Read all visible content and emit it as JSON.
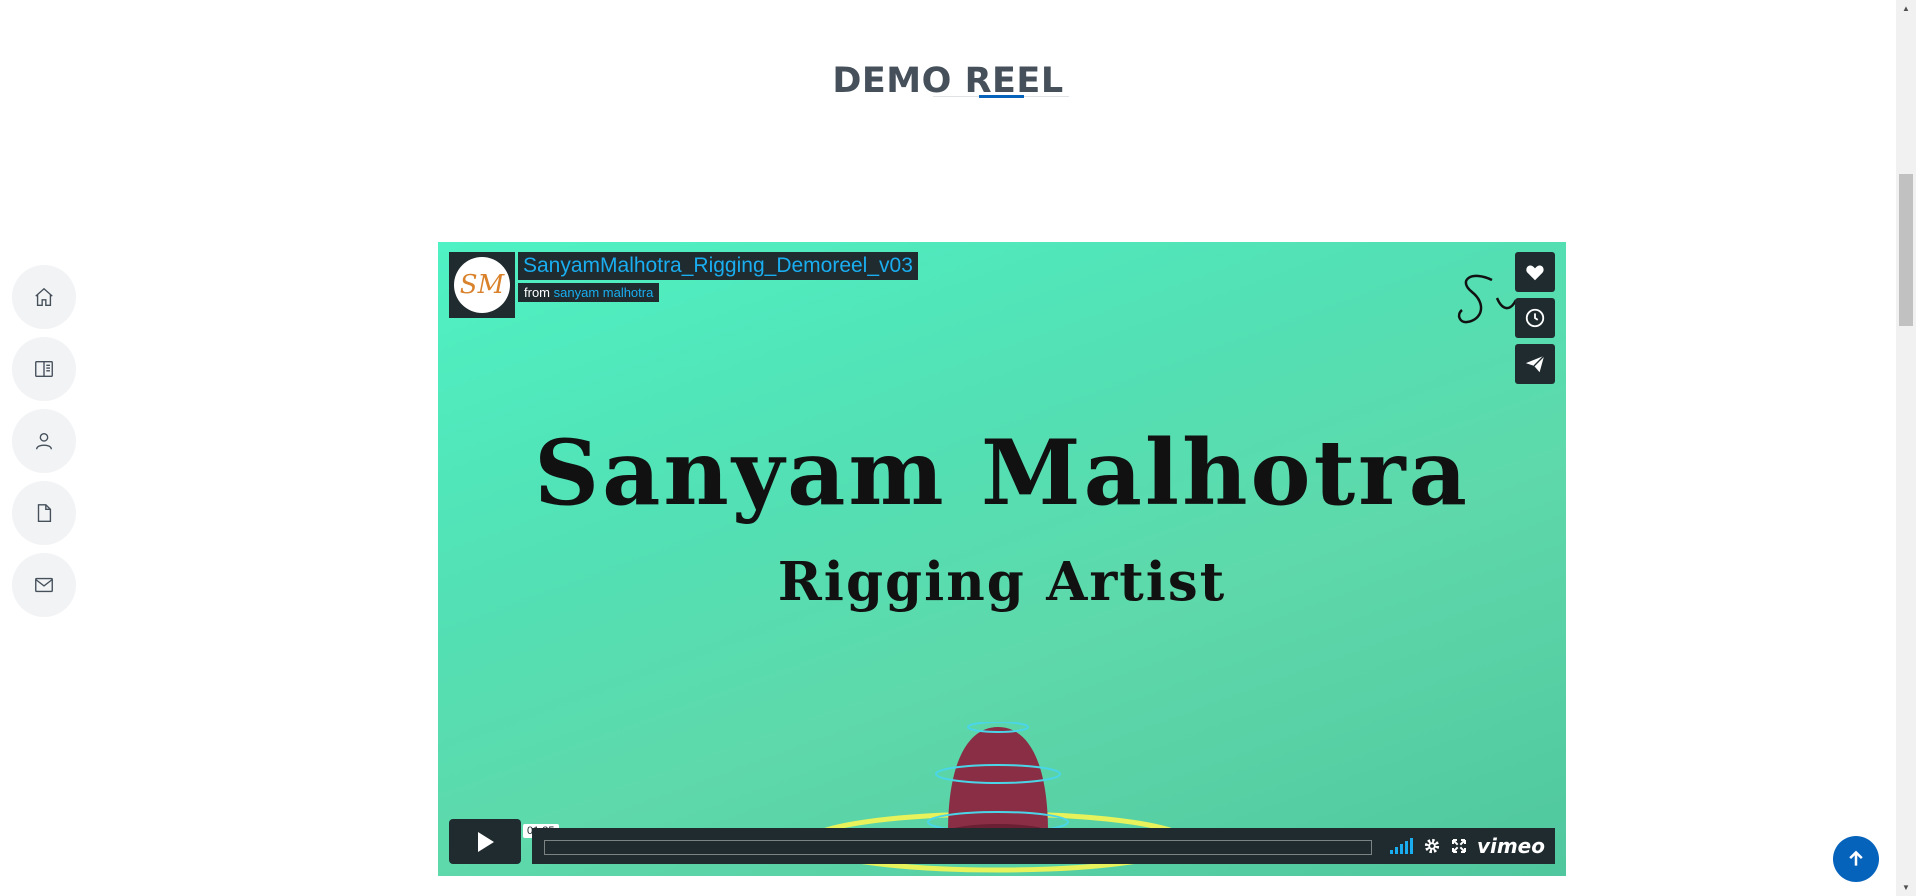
{
  "section": {
    "title": "DEMO REEL"
  },
  "side_nav": {
    "items": [
      {
        "name": "home-icon"
      },
      {
        "name": "book-icon"
      },
      {
        "name": "user-icon"
      },
      {
        "name": "document-icon"
      },
      {
        "name": "mail-icon"
      }
    ]
  },
  "video": {
    "title": "SanyamMalhotra_Rigging_Demoreel_v03",
    "from_label": "from",
    "author": "sanyam malhotra",
    "avatar_initials": "SM",
    "headline": "Sanyam Malhotra",
    "subheadline": "Rigging Artist",
    "duration": "01:35",
    "brand": "vimeo",
    "progress": 0,
    "colors": {
      "accent": "#1aaef0",
      "panel": "#1f2b2f"
    }
  },
  "back_to_top": {
    "icon": "arrow-up-icon",
    "color": "#0563bb"
  }
}
